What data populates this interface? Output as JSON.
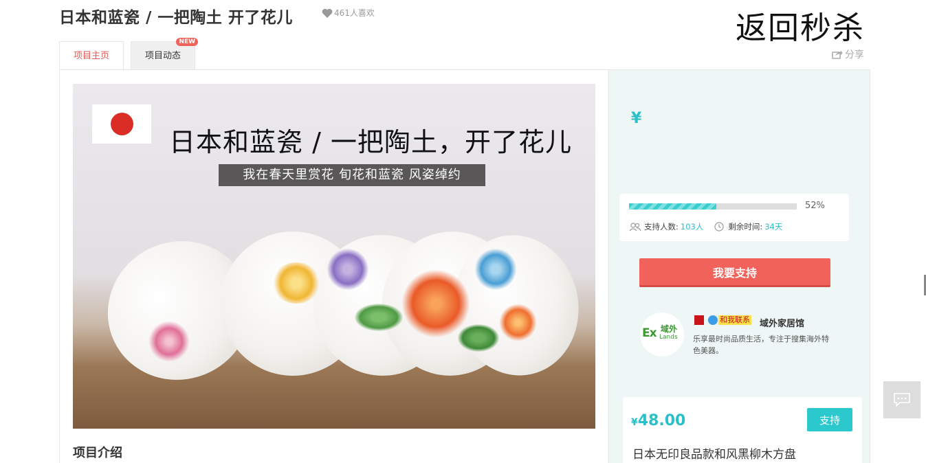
{
  "header": {
    "title": "日本和蓝瓷 / 一把陶土 开了花儿",
    "likes": "461人喜欢",
    "back_link": "返回秒杀",
    "share": "分享"
  },
  "tabs": [
    {
      "label": "项目主页",
      "active": true
    },
    {
      "label": "项目动态",
      "active": false,
      "badge": "NEW"
    }
  ],
  "hero": {
    "title": "日本和蓝瓷 / 一把陶土，开了花儿",
    "subtitle": "我在春天里赏花  旬花和蓝瓷 风姿绰约"
  },
  "section": {
    "intro_heading": "项目介绍"
  },
  "sidebar": {
    "currency": "¥",
    "progress": {
      "percent_label": "52%",
      "fraction": 0.52
    },
    "supporters_label": "支持人数:",
    "supporters_value": "103人",
    "remaining_label": "剩余时间:",
    "remaining_value": "34天",
    "support_button": "我要支持",
    "shop": {
      "logo_ex": "Ex",
      "logo_cn": "域外",
      "logo_lands": "Lands",
      "contact": "和我联系",
      "name": "域外家居馆",
      "description": "乐享最时尚品质生活，专注于搜集海外特色美器。"
    }
  },
  "reward": {
    "currency": "¥",
    "price": "48.00",
    "button": "支持",
    "title": "日本无印良品款和风黑柳木方盘"
  },
  "colors": {
    "accent_red": "#f0625a",
    "accent_teal": "#2bbfc8"
  }
}
